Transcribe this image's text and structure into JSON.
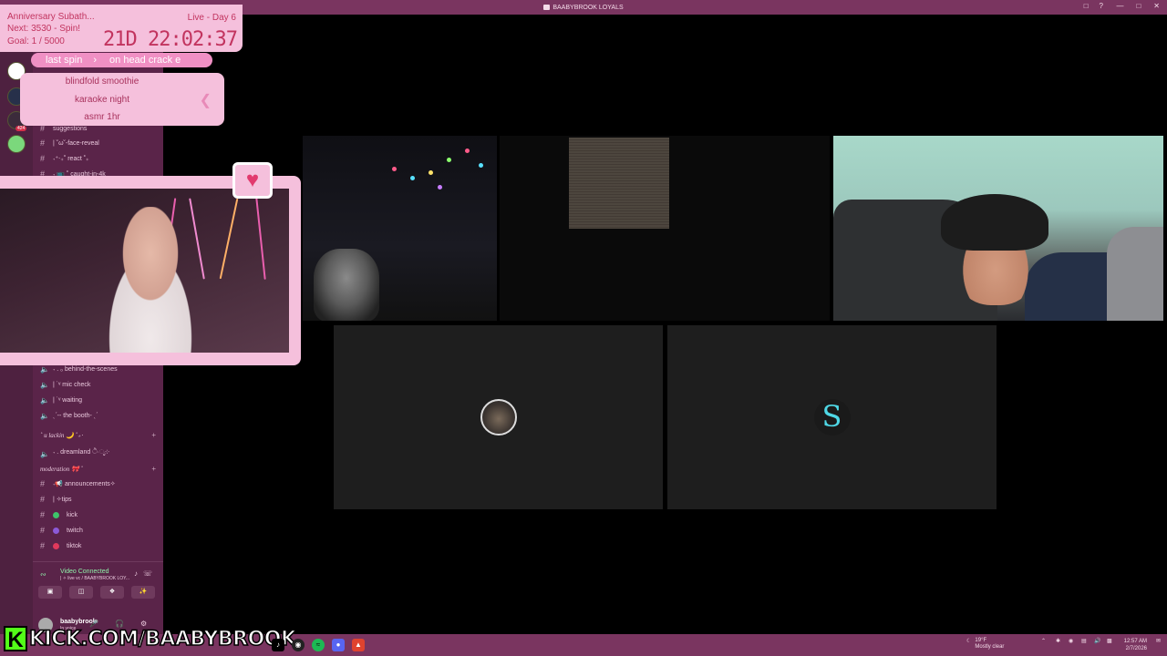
{
  "window": {
    "title": "BAABYBROOK LOYALS",
    "controls": [
      "—",
      "□",
      "✕"
    ]
  },
  "overlay": {
    "subathon_title": "Anniversary Subath...",
    "live_day": "Live - Day 6",
    "next_spin": "Next: 3530 - Spin!",
    "goal": "Goal: 1 / 5000",
    "timer": "21D 22:02:37",
    "last_spin_label": "last spin",
    "last_spin_value": "on head crack e",
    "wheel_items": [
      "blindfold smoothie",
      "karaoke night",
      "asmr 1hr"
    ]
  },
  "server_rail": {
    "badges": [
      "424"
    ]
  },
  "channels": {
    "top": [
      {
        "icon": "hash",
        "label": "suggestions"
      },
      {
        "icon": "hash",
        "label": "| ˘ω˘-face-reveal"
      },
      {
        "icon": "hash",
        "label": "˖⁺‧₊˚ react ˚₊"
      },
      {
        "icon": "hash",
        "label": "˖ 📺 ˚ caught-in-4k"
      }
    ],
    "voice": [
      {
        "icon": "speaker",
        "label": "˖ . ₀ behind-the-scenes"
      },
      {
        "icon": "speaker",
        "label": "| ˙ᵛ mic check"
      },
      {
        "icon": "speaker",
        "label": "| ˙ᵛ waiting"
      },
      {
        "icon": "speaker",
        "label": "ˎˊ-- the booth- ˎˊ"
      }
    ],
    "category_1": "˚ u lackin 🌙 ˚₊‧",
    "dreamland": "˖ . dreamland ੈ‧ೃ༶",
    "category_2": "moderation 🎀 ˚",
    "bottom": [
      {
        "icon": "hash",
        "label": "˖📢 announcements✧",
        "dot": ""
      },
      {
        "icon": "hash",
        "label": "| ✧tips",
        "dot": ""
      },
      {
        "icon": "hash",
        "label": "kick",
        "dot": "#3ec46a"
      },
      {
        "icon": "hash",
        "label": "twitch",
        "dot": "#8c5ad8"
      },
      {
        "icon": "hash",
        "label": "tiktok",
        "dot": "#e0395c"
      }
    ]
  },
  "voice_panel": {
    "status": "Video Connected",
    "channel": "| ✧ live vc / BAABYBROOK LOY..."
  },
  "user_panel": {
    "username": "baabybrook",
    "status": "In voice"
  },
  "tiles": [
    {
      "name": "tile-webcam-room",
      "avatar": ""
    },
    {
      "name": "tile-webcam-dark",
      "avatar": ""
    },
    {
      "name": "tile-webcam-guy",
      "avatar": ""
    },
    {
      "name": "tile-avatar-cat",
      "avatar": "cat"
    },
    {
      "name": "tile-avatar-s",
      "avatar": "S"
    }
  ],
  "brand": {
    "kick_k": "K",
    "kick_url": "KICK.COM/BAABYBROOK",
    "kick_color": "#53fc18",
    "accent_pink": "#f5c0dc",
    "accent_text": "#c2345f"
  },
  "taskbar": {
    "weather_temp": "19°F",
    "weather_desc": "Mostly clear",
    "time": "12:57 AM",
    "date": "2/7/2026"
  }
}
